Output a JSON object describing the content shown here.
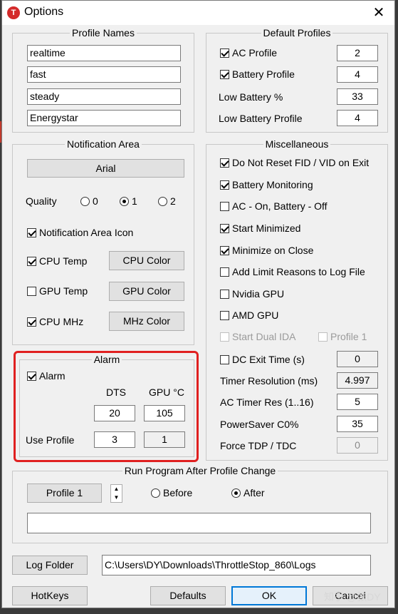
{
  "window": {
    "title": "Options",
    "app_icon_letter": "T"
  },
  "profile_names": {
    "label": "Profile Names",
    "names": [
      "realtime",
      "fast",
      "steady",
      "Energystar"
    ]
  },
  "default_profiles": {
    "label": "Default Profiles",
    "ac_profile": {
      "label": "AC Profile",
      "checked": true,
      "value": "2"
    },
    "battery_profile": {
      "label": "Battery Profile",
      "checked": true,
      "value": "4"
    },
    "low_battery_pct": {
      "label": "Low Battery %",
      "value": "33"
    },
    "low_battery_profile": {
      "label": "Low Battery Profile",
      "value": "4"
    }
  },
  "notification_area": {
    "label": "Notification Area",
    "font_button": "Arial",
    "quality_label": "Quality",
    "quality_options": [
      "0",
      "1",
      "2"
    ],
    "quality_selected": "1",
    "notification_icon": {
      "label": "Notification Area Icon",
      "checked": true
    },
    "cpu_temp": {
      "label": "CPU Temp",
      "checked": true,
      "button": "CPU Color"
    },
    "gpu_temp": {
      "label": "GPU Temp",
      "checked": false,
      "button": "GPU Color"
    },
    "cpu_mhz": {
      "label": "CPU MHz",
      "checked": true,
      "button": "MHz Color"
    }
  },
  "alarm": {
    "label": "Alarm",
    "alarm_checkbox": {
      "label": "Alarm",
      "checked": true
    },
    "dts_label": "DTS",
    "gpu_label": "GPU °C",
    "dts_value": "20",
    "gpu_value": "105",
    "use_profile_label": "Use Profile",
    "profile_a": "3",
    "profile_b": "1"
  },
  "miscellaneous": {
    "label": "Miscellaneous",
    "items": [
      {
        "label": "Do Not Reset FID / VID on Exit",
        "checked": true
      },
      {
        "label": "Battery Monitoring",
        "checked": true
      },
      {
        "label": "AC - On, Battery - Off",
        "checked": false
      },
      {
        "label": "Start Minimized",
        "checked": true
      },
      {
        "label": "Minimize on Close",
        "checked": true
      },
      {
        "label": "Add Limit Reasons to Log File",
        "checked": false
      },
      {
        "label": "Nvidia GPU",
        "checked": false
      },
      {
        "label": "AMD GPU",
        "checked": false
      }
    ],
    "start_dual_ida": {
      "label": "Start Dual IDA",
      "checked": false,
      "disabled": true
    },
    "profile_1": {
      "label": "Profile 1",
      "checked": false,
      "disabled": true
    },
    "dc_exit_time": {
      "label": "DC Exit Time (s)",
      "checked": false,
      "value": "0"
    },
    "timer_resolution": {
      "label": "Timer Resolution (ms)",
      "value": "4.997"
    },
    "ac_timer_res": {
      "label": "AC Timer Res (1..16)",
      "value": "5"
    },
    "powersaver": {
      "label": "PowerSaver C0%",
      "value": "35"
    },
    "force_tdp": {
      "label": "Force TDP / TDC",
      "value": "0"
    }
  },
  "run_program": {
    "label": "Run Program After Profile Change",
    "profile_button": "Profile 1",
    "before_label": "Before",
    "after_label": "After",
    "selected": "After",
    "command": ""
  },
  "bottom": {
    "log_folder_button": "Log Folder",
    "log_path": "C:\\Users\\DY\\Downloads\\ThrottleStop_860\\Logs",
    "hotkeys_button": "HotKeys",
    "defaults_button": "Defaults",
    "ok_button": "OK",
    "cancel_button": "Cancel"
  },
  "watermark": "知乎 @张DY",
  "colors": {
    "highlight": "#e02020",
    "ok_border": "#0078d7",
    "app_icon": "#d42a2a"
  }
}
